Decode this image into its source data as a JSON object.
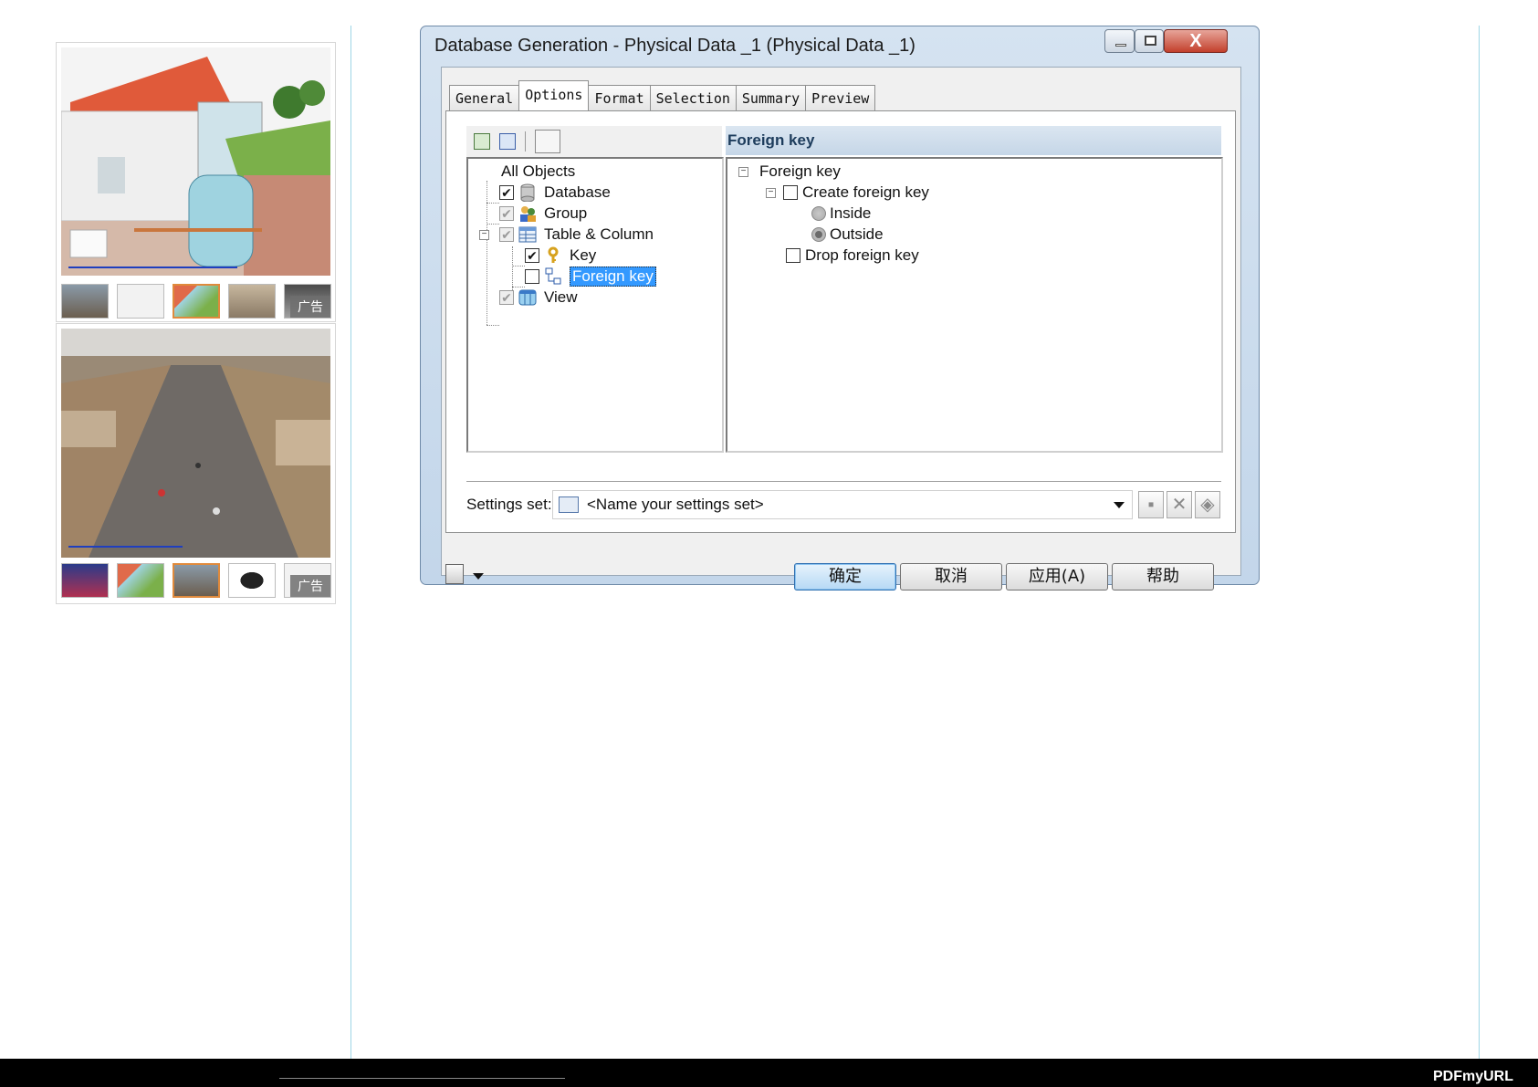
{
  "ads": [
    {
      "tag": "广告",
      "thumb_count": 5,
      "active_thumb": 2
    },
    {
      "tag": "广告",
      "thumb_count": 5,
      "active_thumb": 2
    }
  ],
  "dialog": {
    "title": "Database Generation - Physical Data _1 (Physical Data _1)",
    "close_glyph": "X",
    "tabs": [
      "General",
      "Options",
      "Format",
      "Selection",
      "Summary",
      "Preview"
    ],
    "active_tab": "Options",
    "tree": {
      "root": "All Objects",
      "items": [
        {
          "label": "Database",
          "checked": true
        },
        {
          "label": "Group",
          "checked": true,
          "gray": true
        },
        {
          "label": "Table & Column",
          "checked": true,
          "gray": true
        },
        {
          "label": "Key",
          "checked": true
        },
        {
          "label": "Foreign key",
          "checked": false,
          "selected": true
        },
        {
          "label": "View",
          "checked": true,
          "gray": true
        }
      ]
    },
    "properties": {
      "header": "Foreign key",
      "section": "Foreign key",
      "create_fk": {
        "label": "Create foreign key",
        "checked": false
      },
      "inside": {
        "label": "Inside",
        "checked": false
      },
      "outside": {
        "label": "Outside",
        "checked": true
      },
      "drop_fk": {
        "label": "Drop foreign key",
        "checked": false
      }
    },
    "settings": {
      "label": "Settings set:",
      "value": "<Name your settings set>"
    },
    "buttons": {
      "ok": "确定",
      "cancel": "取消",
      "apply": "应用(A)",
      "help": "帮助"
    }
  },
  "footer": {
    "brand": "PDFmyURL"
  }
}
